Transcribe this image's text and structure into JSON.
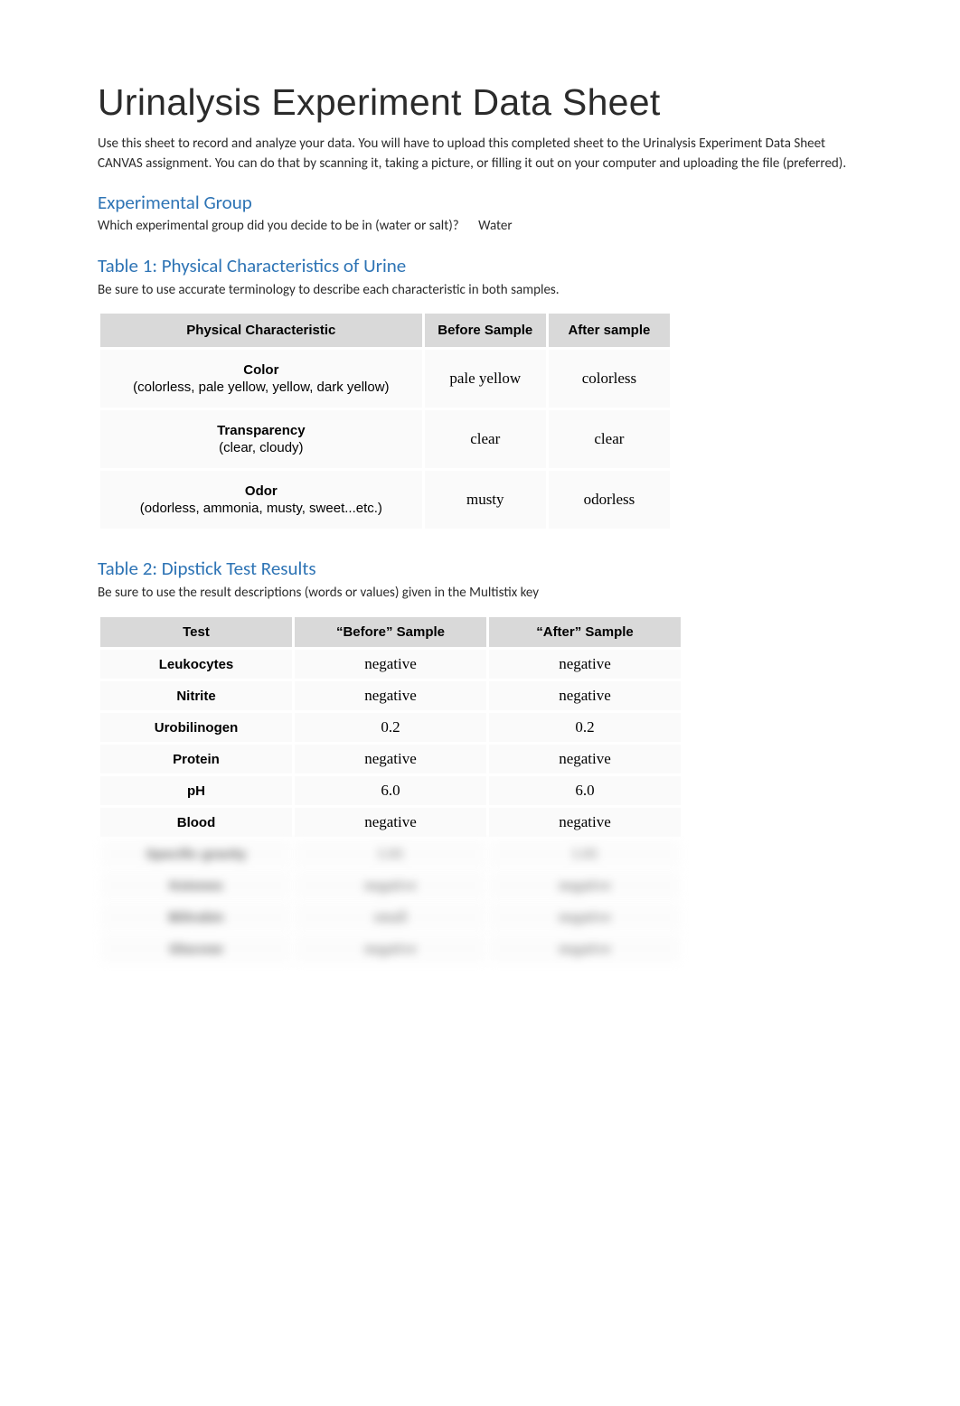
{
  "title": "Urinalysis Experiment Data Sheet",
  "intro": "Use this sheet to record and analyze your data. You will have to upload this completed sheet to the Urinalysis Experiment Data Sheet CANVAS assignment. You can do that by scanning it, taking a picture, or filling it out on your computer and uploading the file (preferred).",
  "sections": {
    "group": {
      "heading": "Experimental Group",
      "question": "Which experimental group did you decide to be in (water or salt)?",
      "answer": "Water"
    },
    "table1": {
      "heading": "Table 1: Physical Characteristics of Urine",
      "desc": "Be sure to use accurate terminology to describe each characteristic in both samples.",
      "headers": {
        "col1": "Physical Characteristic",
        "col2": "Before Sample",
        "col3": "After sample"
      },
      "rows": [
        {
          "label_main": "Color",
          "label_sub": "(colorless, pale yellow, yellow, dark yellow)",
          "before": "pale yellow",
          "after": "colorless"
        },
        {
          "label_main": "Transparency",
          "label_sub": "(clear, cloudy)",
          "before": "clear",
          "after": "clear"
        },
        {
          "label_main": "Odor",
          "label_sub": "(odorless, ammonia, musty, sweet...etc.)",
          "before": "musty",
          "after": "odorless"
        }
      ]
    },
    "table2": {
      "heading": "Table 2: Dipstick Test Results",
      "desc": "Be sure to use the result descriptions (words or values) given in the Multistix key",
      "headers": {
        "col1": "Test",
        "col2": "“Before” Sample",
        "col3": "“After” Sample"
      },
      "rows": [
        {
          "test": "Leukocytes",
          "before": "negative",
          "after": "negative"
        },
        {
          "test": "Nitrite",
          "before": "negative",
          "after": "negative"
        },
        {
          "test": "Urobilinogen",
          "before": "0.2",
          "after": "0.2"
        },
        {
          "test": "Protein",
          "before": "negative",
          "after": "negative"
        },
        {
          "test": "pH",
          "before": "6.0",
          "after": "6.0"
        },
        {
          "test": "Blood",
          "before": "negative",
          "after": "negative"
        }
      ],
      "blurred_rows": [
        {
          "test": "Specific gravity",
          "before": "1.01",
          "after": "1.01"
        },
        {
          "test": "Ketones",
          "before": "negative",
          "after": "negative"
        },
        {
          "test": "Bilirubin",
          "before": "small",
          "after": "negative"
        },
        {
          "test": "Glucose",
          "before": "negative",
          "after": "negative"
        }
      ]
    }
  }
}
